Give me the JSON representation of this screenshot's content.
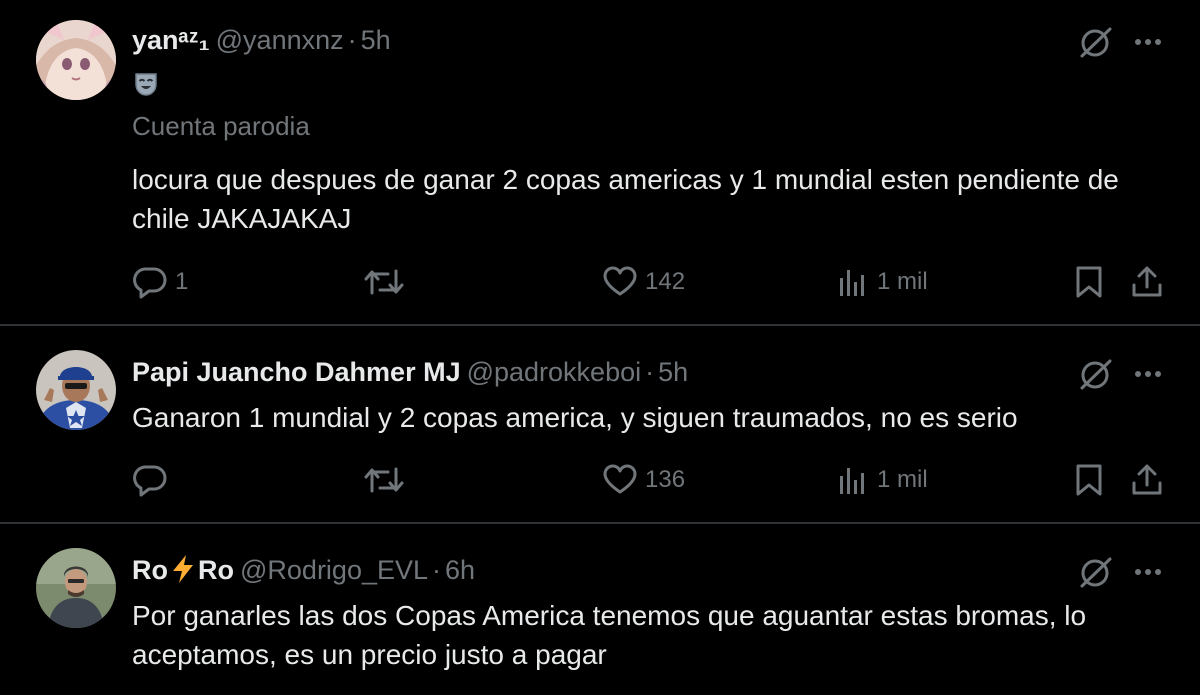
{
  "tweets": [
    {
      "name": "yanᵃᶻ₁",
      "handle": "@yannxnz",
      "separator": "·",
      "time": "5h",
      "parody_label": "Cuenta parodia",
      "text": "locura que despues de ganar 2 copas americas y 1 mundial esten pendiente de chile JAKAJAKAJ",
      "reply_count": "1",
      "like_count": "142",
      "views_count": "1 mil",
      "avatar_icon": "anime-girl-avatar",
      "badge_icon": "theater-mask-icon"
    },
    {
      "name": "Papi Juancho Dahmer MJ",
      "handle": "@padrokkeboi",
      "separator": "·",
      "time": "5h",
      "text": "Ganaron 1 mundial y 2 copas america, y siguen traumados, no es serio",
      "like_count": "136",
      "views_count": "1 mil",
      "avatar_icon": "man-in-cap-avatar"
    },
    {
      "name_part1": "Ro",
      "name_part2": "Ro",
      "name_emoji": "lightning-bolt-icon",
      "handle": "@Rodrigo_EVL",
      "separator": "·",
      "time": "6h",
      "text": "Por ganarles las dos Copas America tenemos que aguantar estas bromas, lo aceptamos, es un precio justo a pagar",
      "avatar_icon": "man-outdoor-avatar"
    }
  ],
  "colors": {
    "background": "#000000",
    "text_primary": "#e7e9ea",
    "text_secondary": "#71767b",
    "divider": "#2f3336",
    "lightning": "#ffac33"
  }
}
